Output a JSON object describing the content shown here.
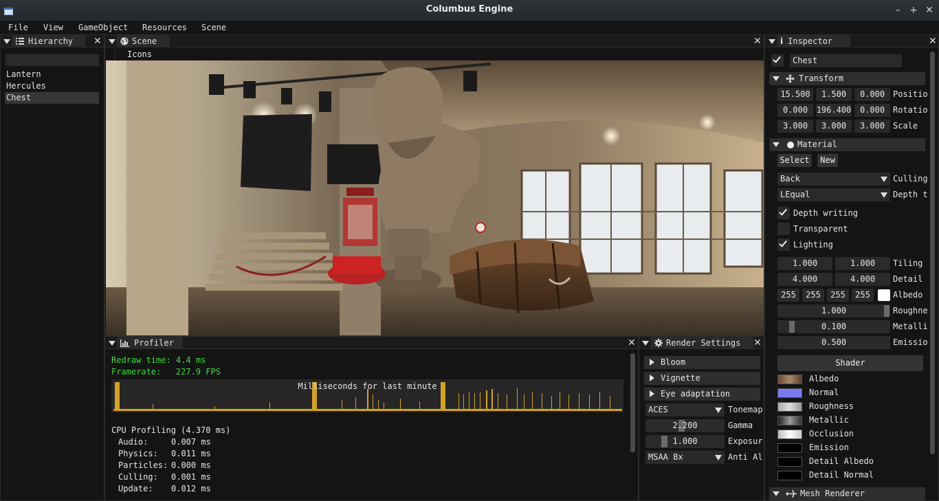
{
  "window": {
    "title": "Columbus Engine",
    "buttons": [
      "–",
      "+",
      "✕"
    ]
  },
  "menu": [
    "File",
    "View",
    "GameObject",
    "Resources",
    "Scene"
  ],
  "hierarchy": {
    "tab": "Hierarchy",
    "search_value": "",
    "items": [
      "Lantern",
      "Hercules",
      "Chest"
    ],
    "selected": "Chest"
  },
  "scene": {
    "tab": "Scene",
    "toolbar_label": "Icons"
  },
  "profiler": {
    "tab": "Profiler",
    "redraw": "Redraw time: 4.4 ms",
    "framerate": "Framerate:   227.9 FPS",
    "graph_title": "Milliseconds for last minute",
    "cpu_title": "CPU Profiling (4.370 ms)",
    "rows": [
      {
        "label": "Audio:",
        "value": "0.007 ms"
      },
      {
        "label": "Physics:",
        "value": "0.011 ms"
      },
      {
        "label": "Particles:",
        "value": "0.000 ms"
      },
      {
        "label": "Culling:",
        "value": "0.001 ms"
      },
      {
        "label": "Update:",
        "value": "0.012 ms"
      }
    ],
    "colors": {
      "text_green": "#3ddc3d",
      "graph_bar": "#d4a12a"
    }
  },
  "render_settings": {
    "tab": "Render Settings",
    "sections": [
      "Bloom",
      "Vignette",
      "Eye adaptation"
    ],
    "tonemap": {
      "value": "ACES",
      "label": "Tonemap"
    },
    "gamma": {
      "value": "2.200",
      "label": "Gamma"
    },
    "exposure": {
      "value": "1.000",
      "label": "Exposur"
    },
    "antialias": {
      "value": "MSAA 8x",
      "label": "Anti Al"
    }
  },
  "inspector": {
    "tab": "Inspector",
    "object_name": "Chest",
    "transform": {
      "title": "Transform",
      "position": {
        "x": "15.500",
        "y": "1.500",
        "z": "0.000",
        "label": "Positio"
      },
      "rotation": {
        "x": "0.000",
        "y": "196.400",
        "z": "0.000",
        "label": "Rotatio"
      },
      "scale": {
        "x": "3.000",
        "y": "3.000",
        "z": "3.000",
        "label": "Scale"
      }
    },
    "material": {
      "title": "Material",
      "select_label": "Select",
      "new_label": "New",
      "culling": {
        "value": "Back",
        "label": "Culling"
      },
      "depth_test": {
        "value": "LEqual",
        "label": "Depth t"
      },
      "depth_writing": "Depth writing",
      "transparent": "Transparent",
      "lighting": "Lighting",
      "tiling": {
        "x": "1.000",
        "y": "1.000",
        "label": "Tiling"
      },
      "detail": {
        "x": "4.000",
        "y": "4.000",
        "label": "Detail"
      },
      "albedo": {
        "r": "255",
        "g": "255",
        "b": "255",
        "a": "255",
        "label": "Albedo"
      },
      "roughness": {
        "value": "1.000",
        "label": "Roughne"
      },
      "metallic": {
        "value": "0.100",
        "label": "Metalli"
      },
      "emission": {
        "value": "0.500",
        "label": "Emissio"
      },
      "shader_label": "Shader",
      "textures": [
        "Albedo",
        "Normal",
        "Roughness",
        "Metallic",
        "Occlusion",
        "Emission",
        "Detail Albedo",
        "Detail Normal"
      ]
    },
    "mesh_renderer": "Mesh Renderer"
  }
}
